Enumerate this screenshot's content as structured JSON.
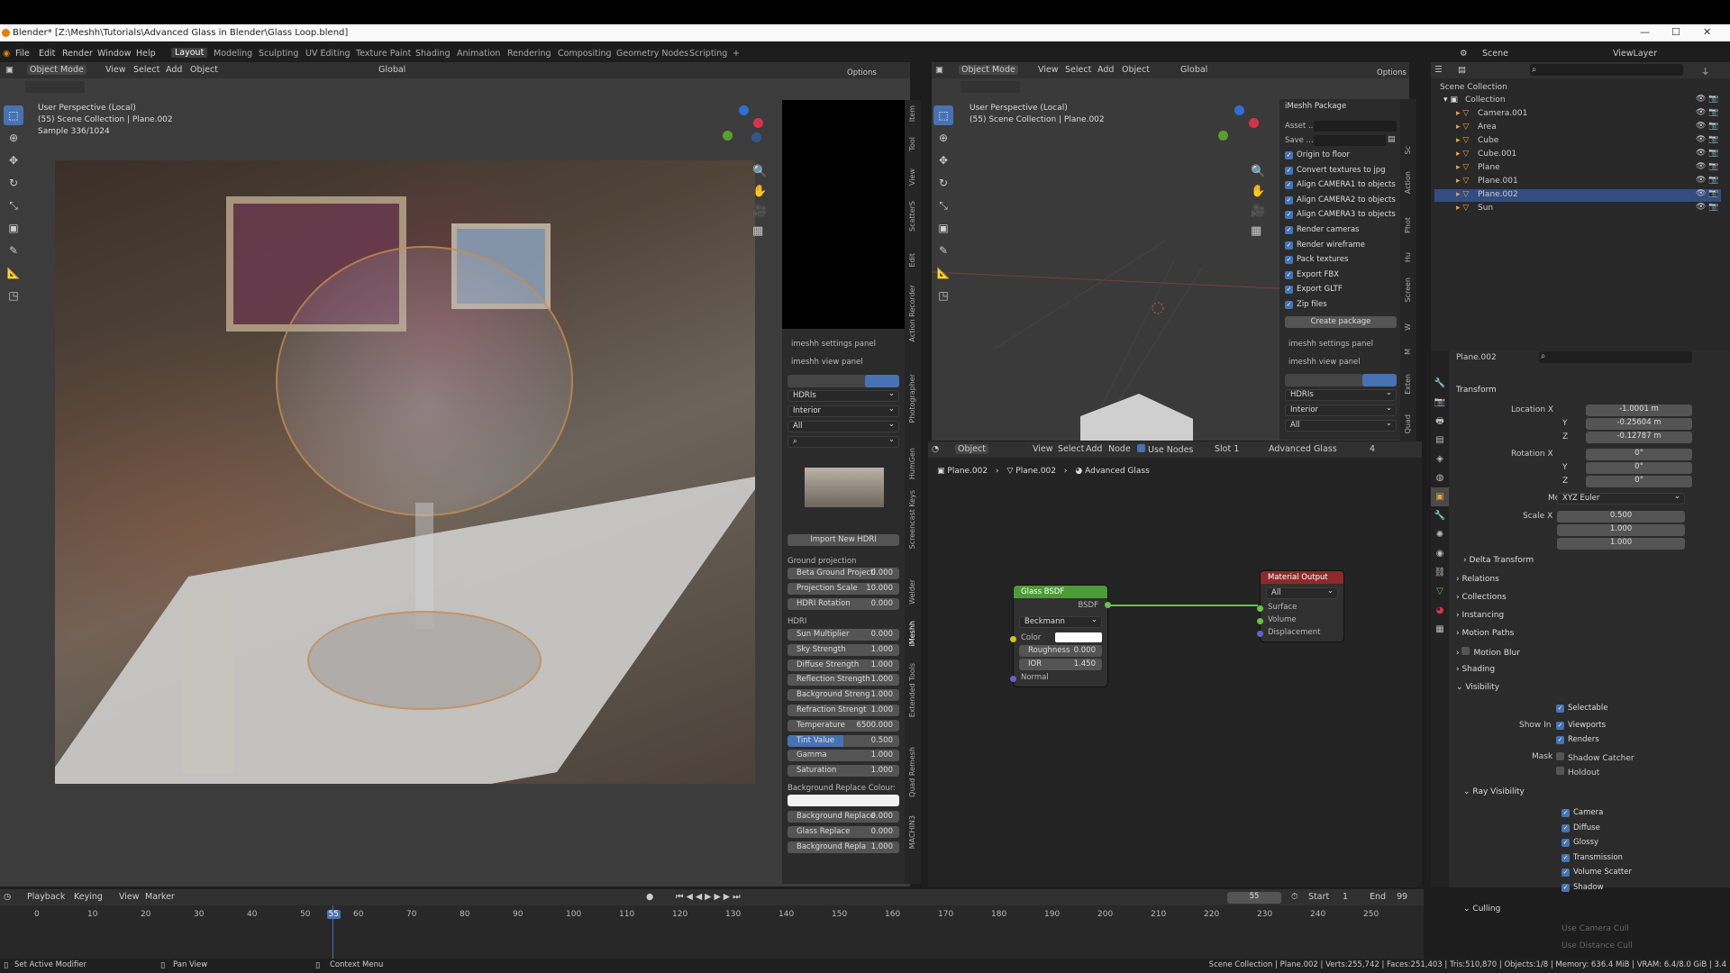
{
  "title": "Blender* [Z:\\Meshh\\Tutorials\\Advanced Glass in Blender\\Glass Loop.blend]",
  "menu": [
    "File",
    "Edit",
    "Render",
    "Window",
    "Help"
  ],
  "workspaces": [
    "Layout",
    "Modeling",
    "Sculpting",
    "UV Editing",
    "Texture Paint",
    "Shading",
    "Animation",
    "Rendering",
    "Compositing",
    "Geometry Nodes",
    "Scripting",
    "+"
  ],
  "scene": "Scene",
  "view_layer": "ViewLayer",
  "left_viewport": {
    "header": {
      "mode": "Object Mode",
      "menus": [
        "View",
        "Select",
        "Add",
        "Object"
      ],
      "orientation": "Global",
      "options": "Options"
    },
    "overlay": [
      "User Perspective (Local)",
      "(55) Scene Collection | Plane.002",
      "Sample 336/1024"
    ]
  },
  "imeshh_left": {
    "settings_panel": "imeshh settings panel",
    "view_panel": "imeshh view panel",
    "dropdowns": [
      "HDRIs",
      "Interior",
      "All"
    ],
    "import_button": "Import New HDRI",
    "ground_projection_label": "Ground projection",
    "ground_rows": [
      {
        "label": "Beta Ground Projecti",
        "value": "0.000"
      },
      {
        "label": "Projection Scale",
        "value": "10.000"
      },
      {
        "label": "HDRI Rotation",
        "value": "0.000"
      }
    ],
    "hdri_label": "HDRI",
    "hdri_rows": [
      {
        "label": "Sun Multiplier",
        "value": "0.000"
      },
      {
        "label": "Sky Strength",
        "value": "1.000"
      },
      {
        "label": "Diffuse Strength",
        "value": "1.000"
      },
      {
        "label": "Reflection Strength",
        "value": "1.000"
      },
      {
        "label": "Background Streng",
        "value": "1.000"
      },
      {
        "label": "Refraction Strengt",
        "value": "1.000"
      },
      {
        "label": "Temperature",
        "value": "6500.000"
      },
      {
        "label": "Tint Value",
        "value": "0.500"
      },
      {
        "label": "Gamma",
        "value": "1.000"
      },
      {
        "label": "Saturation",
        "value": "1.000"
      }
    ],
    "bg_replace_label": "Background Replace Colour:",
    "replace_rows": [
      {
        "label": "Background Replace",
        "value": "0.000"
      },
      {
        "label": "Glass Replace",
        "value": "0.000"
      },
      {
        "label": "Background Repla",
        "value": "1.000"
      }
    ]
  },
  "left_tabs": [
    "Item",
    "Tool",
    "View",
    "ScatterS",
    "Edit",
    "Action Recorder",
    "Photographer",
    "HumGen",
    "Screencast Keys",
    "Welder",
    "iMeshh",
    "Extended Tools",
    "Quad Remesh",
    "MACHIN3"
  ],
  "right_viewport": {
    "header": {
      "mode": "Object Mode",
      "menus": [
        "View",
        "Select",
        "Add",
        "Object"
      ],
      "orientation": "Global",
      "options": "Options"
    },
    "overlay": [
      "User Perspective (Local)",
      "(55) Scene Collection | Plane.002"
    ]
  },
  "package_panel": {
    "title": "iMeshh Package",
    "asset_label": "Asset ...",
    "save_label": "Save ...",
    "checks": [
      "Origin to floor",
      "Convert textures to jpg",
      "Align CAMERA1 to objects",
      "Align CAMERA2 to objects",
      "Align CAMERA3 to objects",
      "Render cameras",
      "Render wireframe",
      "Pack textures",
      "Export FBX",
      "Export GLTF",
      "Zip files"
    ],
    "create_button": "Create package",
    "settings_panel": "imeshh settings panel",
    "view_panel": "imeshh view panel",
    "dropdowns": [
      "HDRIs",
      "Interior",
      "All"
    ]
  },
  "right_tabs": [
    "Sc",
    "Action",
    "Phot",
    "Hu",
    "Screen",
    "W",
    "M",
    "Exten",
    "Quad",
    "MA"
  ],
  "node_editor": {
    "header": {
      "type": "Object",
      "menus": [
        "View",
        "Select",
        "Add",
        "Node"
      ],
      "use_nodes": "Use Nodes",
      "slot": "Slot 1",
      "material": "Advanced Glass",
      "users": "4"
    },
    "breadcrumb": [
      "Plane.002",
      "Plane.002",
      "Advanced Glass"
    ],
    "glass_node": {
      "title": "Glass BSDF",
      "output": "BSDF",
      "distribution": "Beckmann",
      "color": "Color",
      "roughness_label": "Roughness",
      "roughness": "0.000",
      "ior_label": "IOR",
      "ior": "1.450",
      "normal": "Normal"
    },
    "output_node": {
      "title": "Material Output",
      "target": "All",
      "inputs": [
        "Surface",
        "Volume",
        "Displacement"
      ]
    }
  },
  "outliner": {
    "root": "Scene Collection",
    "items": [
      {
        "name": "Collection",
        "level": 0
      },
      {
        "name": "Camera.001",
        "level": 1
      },
      {
        "name": "Area",
        "level": 1
      },
      {
        "name": "Cube",
        "level": 1
      },
      {
        "name": "Cube.001",
        "level": 1
      },
      {
        "name": "Plane",
        "level": 1
      },
      {
        "name": "Plane.001",
        "level": 1
      },
      {
        "name": "Plane.002",
        "level": 1,
        "selected": true
      },
      {
        "name": "Sun",
        "level": 1
      }
    ]
  },
  "properties": {
    "object_name": "Plane.002",
    "transform": "Transform",
    "location": {
      "label": "Location X",
      "x": "-1.0001 m",
      "y": "-0.25604 m",
      "z": "-0.12787 m"
    },
    "rotation": {
      "label": "Rotation X",
      "x": "0°",
      "y": "0°",
      "z": "0°"
    },
    "mode_label": "Mode",
    "mode": "XYZ Euler",
    "scale": {
      "label": "Scale X",
      "x": "0.500",
      "y": "1.000",
      "z": "1.000"
    },
    "axis_y": "Y",
    "axis_z": "Z",
    "sections": [
      "Delta Transform",
      "Relations",
      "Collections",
      "Instancing",
      "Motion Paths",
      "Motion Blur",
      "Shading",
      "Visibility"
    ],
    "selectable": "Selectable",
    "show_in": "Show In",
    "viewports": "Viewports",
    "renders": "Renders",
    "mask": "Mask",
    "shadow_catcher": "Shadow Catcher",
    "holdout": "Holdout",
    "ray_visibility": "Ray Visibility",
    "rays": [
      "Camera",
      "Diffuse",
      "Glossy",
      "Transmission",
      "Volume Scatter",
      "Shadow"
    ],
    "culling": "Culling",
    "culling_items": [
      "Use Camera Cull",
      "Use Distance Cull"
    ]
  },
  "timeline": {
    "menus": [
      "Playback",
      "Keying",
      "View",
      "Marker"
    ],
    "ticks": [
      "0",
      "10",
      "20",
      "30",
      "40",
      "50",
      "55",
      "60",
      "70",
      "80",
      "90",
      "100",
      "110",
      "120",
      "130",
      "140",
      "150",
      "160",
      "170",
      "180",
      "190",
      "200",
      "210",
      "220",
      "230",
      "240",
      "250"
    ],
    "frame": "55",
    "start_label": "Start",
    "start": "1",
    "end_label": "End",
    "end": "99"
  },
  "statusbar": {
    "left": [
      "Set Active Modifier",
      "Pan View",
      "Context Menu"
    ],
    "right": "Scene Collection | Plane.002 | Verts:255,742 | Faces:251,403 | Tris:510,870 | Objects:1/8 | Memory: 636.4 MiB | VRAM: 6.4/8.0 GiB | 3.4"
  },
  "colors": {
    "accent": "#4772b3",
    "node_green": "#4c9b38",
    "node_red": "#8c2a2a",
    "selected_row": "#334d80"
  }
}
